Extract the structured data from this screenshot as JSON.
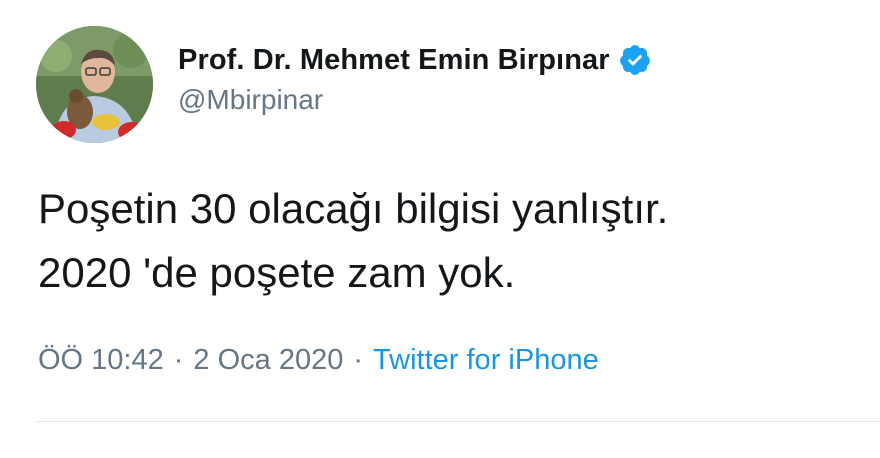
{
  "author": {
    "display_name": "Prof. Dr. Mehmet Emin Birpınar",
    "handle": "@Mbirpinar",
    "verified": true,
    "avatar_icon": "profile-photo"
  },
  "tweet": {
    "lines": [
      "Poşetin 30 olacağı bilgisi yanlıştır.",
      "2020 'de poşete zam yok."
    ]
  },
  "meta": {
    "time": "ÖÖ 10:42",
    "separator": "·",
    "date": "2 Oca 2020",
    "source": "Twitter for iPhone"
  },
  "colors": {
    "text": "#14171a",
    "secondary": "#657786",
    "link": "#1b95e0",
    "verified": "#1da1f2",
    "divider": "#e1e8ed"
  }
}
